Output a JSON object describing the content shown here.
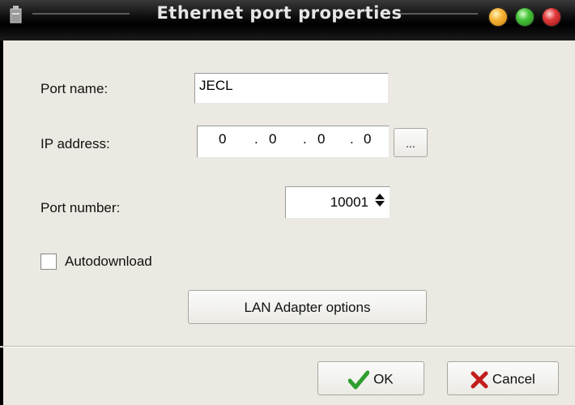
{
  "window": {
    "title": "Ethernet port properties"
  },
  "form": {
    "port_name_label": "Port name:",
    "port_name_value": "JECL",
    "ip_label": "IP address:",
    "ip_octets": [
      "0",
      "0",
      "0",
      "0"
    ],
    "ip_separator": ".",
    "ip_browse_label": "...",
    "port_number_label": "Port number:",
    "port_number_value": "10001",
    "autodownload_label": "Autodownload",
    "autodownload_checked": false,
    "lan_button_label": "LAN Adapter options"
  },
  "footer": {
    "ok_label": "OK",
    "cancel_label": "Cancel"
  },
  "icons": {
    "ok": "checkmark-icon",
    "cancel": "x-icon",
    "spin": "spin-arrows-icon"
  },
  "colors": {
    "ok_check": "#2e9e2e",
    "cancel_x": "#c21d1d"
  }
}
